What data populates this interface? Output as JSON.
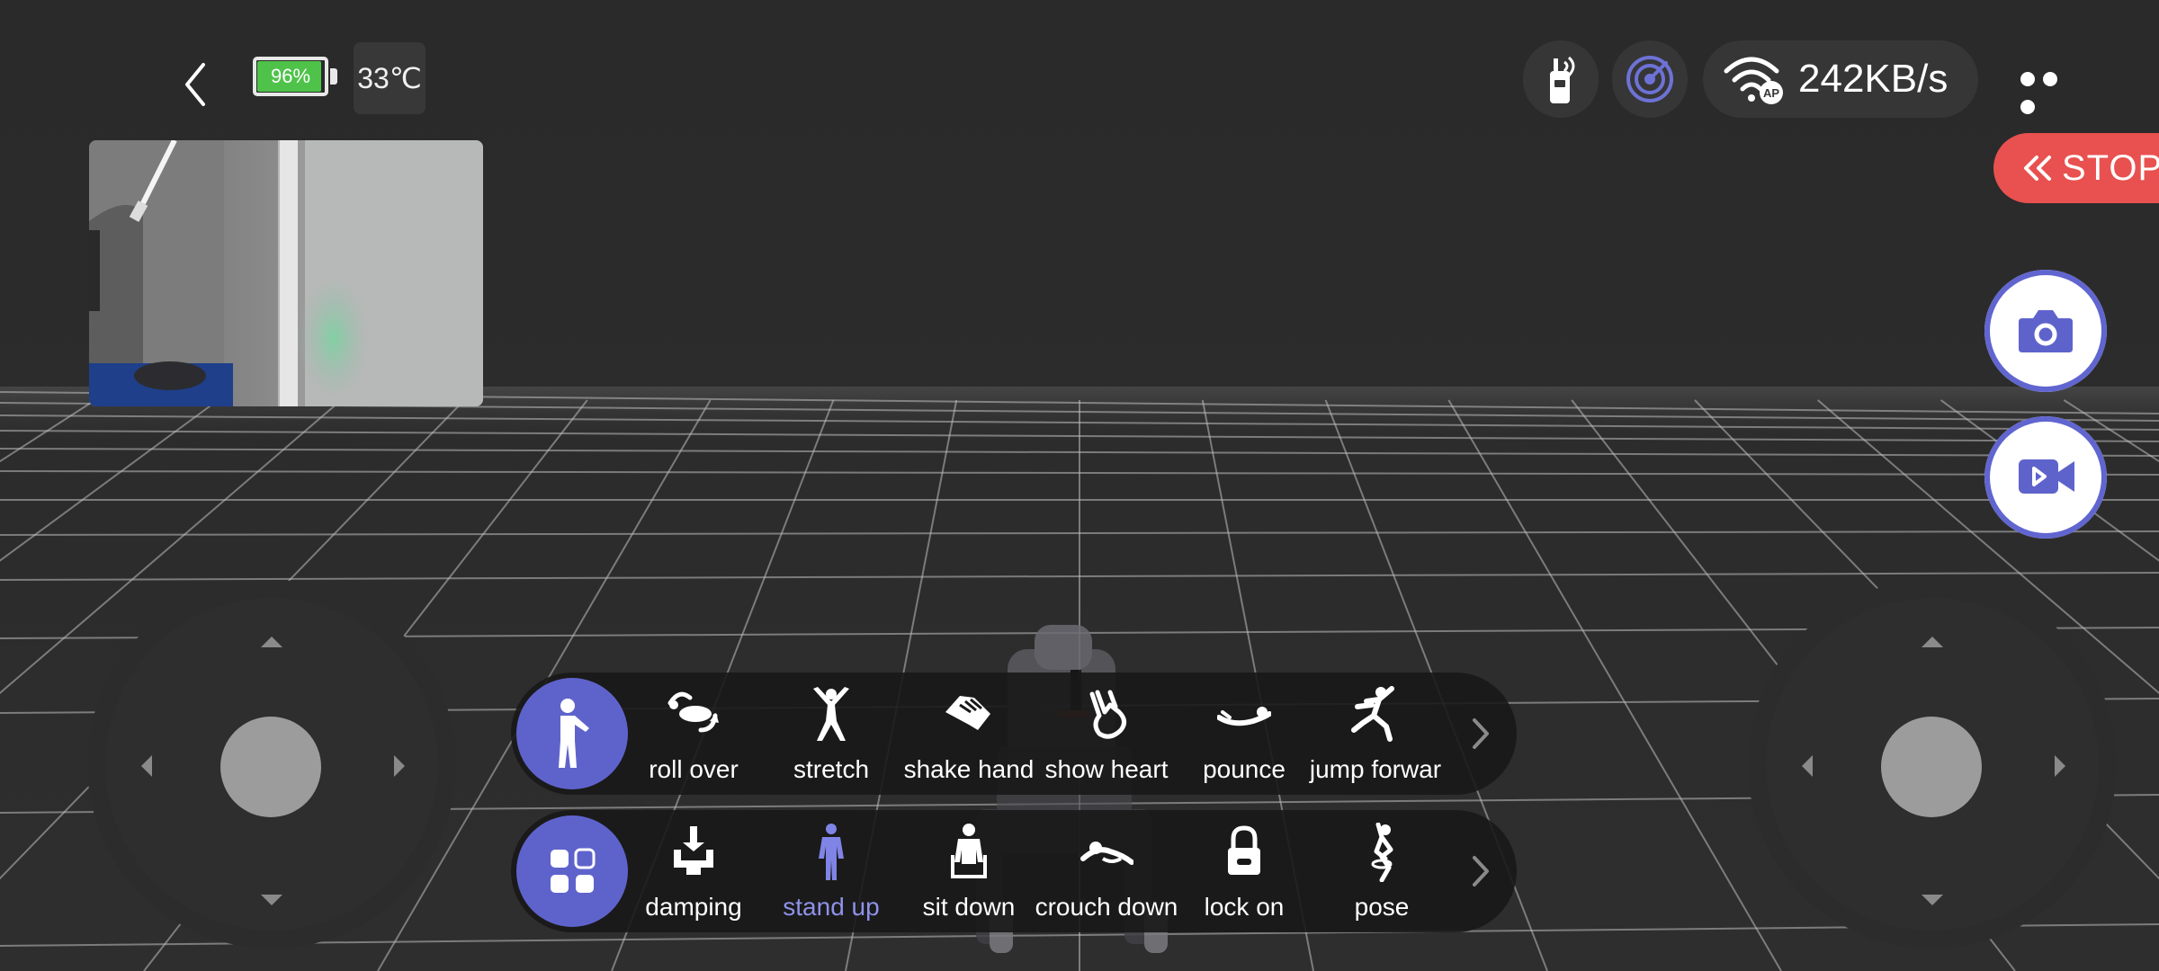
{
  "status": {
    "battery_label": "96%",
    "battery_level": 0.96,
    "temperature": "33℃",
    "network_speed": "242KB/s",
    "wifi_badge": "AP"
  },
  "stop_label": "STOP",
  "icons": {
    "back": "chevron-left-icon",
    "walkie": "walkie-talkie-icon",
    "radar": "radar-icon",
    "wifi": "wifi-icon",
    "more": "more-icon",
    "stop": "double-chevron-left-icon",
    "photo": "camera-icon",
    "video": "video-icon"
  },
  "action_bar_1": {
    "mode_icon": "person-pointing-icon",
    "items": [
      {
        "label": "roll over",
        "icon": "roll-over-icon"
      },
      {
        "label": "stretch",
        "icon": "stretch-icon"
      },
      {
        "label": "shake hand",
        "icon": "shake-hand-icon"
      },
      {
        "label": "show heart",
        "icon": "show-heart-icon"
      },
      {
        "label": "pounce",
        "icon": "pounce-icon"
      },
      {
        "label": "jump forwar",
        "icon": "jump-forward-icon"
      }
    ]
  },
  "action_bar_2": {
    "mode_icon": "grid-apps-icon",
    "items": [
      {
        "label": "damping",
        "icon": "damping-icon"
      },
      {
        "label": "stand up",
        "icon": "stand-up-icon",
        "active": true
      },
      {
        "label": "sit down",
        "icon": "sit-down-icon"
      },
      {
        "label": "crouch down",
        "icon": "crouch-down-icon"
      },
      {
        "label": "lock on",
        "icon": "lock-icon"
      },
      {
        "label": "pose",
        "icon": "pose-icon"
      }
    ]
  },
  "colors": {
    "accent": "#5e63cc",
    "active_label": "#8e92ea",
    "stop": "#e8514f",
    "battery": "#4fc24a",
    "background": "#2b2b2b"
  }
}
